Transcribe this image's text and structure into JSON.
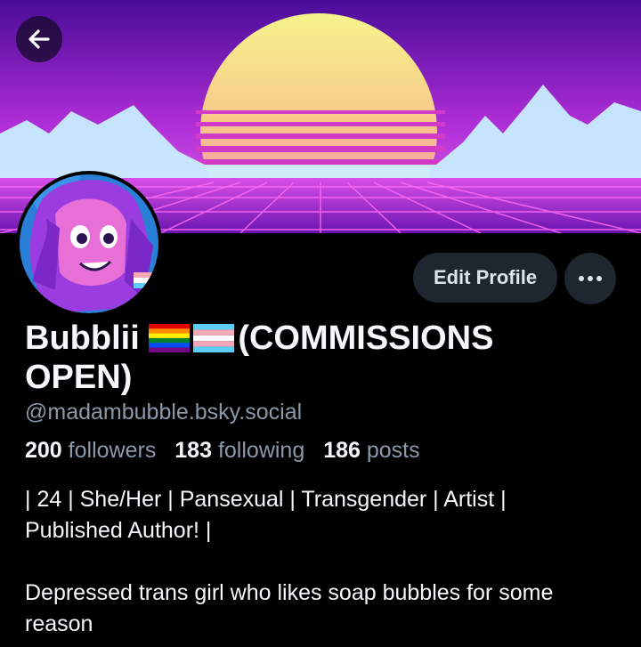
{
  "header": {
    "back_icon": "arrow-left-icon",
    "banner_colors": {
      "sky_top": "#5a10a8",
      "sky_mid": "#b22fd8",
      "sun_top": "#f3f08a",
      "sun_bottom": "#f06ec8",
      "grid": "#ff5cf0",
      "mountains": "#cff6ff"
    }
  },
  "profile": {
    "display_name_line1": "Bubblii ",
    "display_name_suffix": "(COMMISSIONS",
    "display_name_line2": "OPEN)",
    "flags": [
      "rainbow-pride-flag",
      "transgender-flag"
    ],
    "handle": "@madambubble.bsky.social",
    "followers_count": "200",
    "followers_label": "followers",
    "following_count": "183",
    "following_label": "following",
    "posts_count": "186",
    "posts_label": "posts",
    "bio_line1": "| 24 | She/Her | Pansexual | Transgender | Artist |",
    "bio_line2": "Published Author! |",
    "bio_line3": "Depressed trans girl who likes soap bubbles for some",
    "bio_line4": "reason"
  },
  "actions": {
    "edit_profile_label": "Edit Profile",
    "more_icon": "ellipsis-icon"
  }
}
